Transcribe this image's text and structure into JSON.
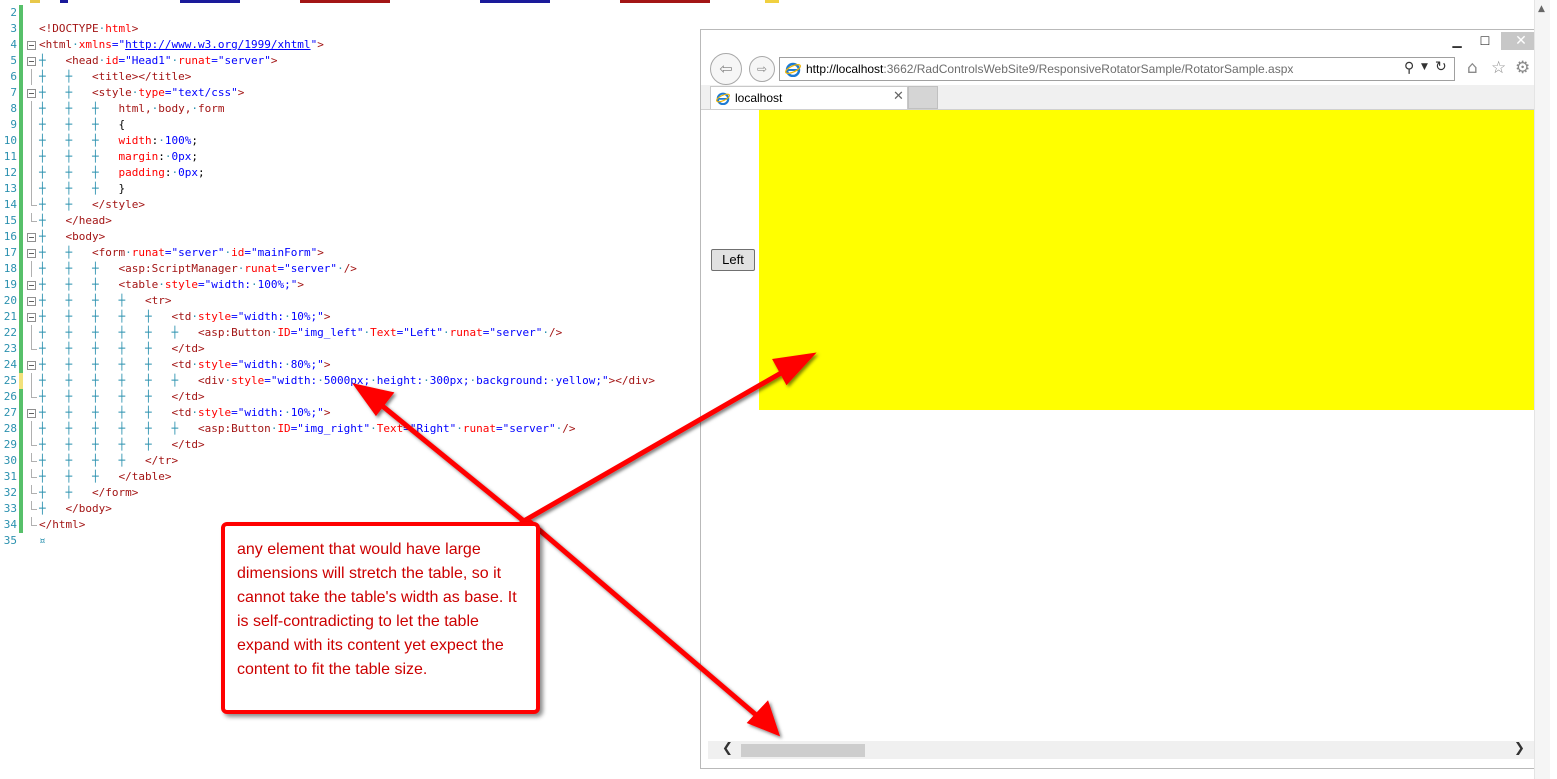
{
  "editor": {
    "lines": [
      {
        "n": "2",
        "chg": "saved",
        "fold": "none",
        "tokens": []
      },
      {
        "n": "3",
        "chg": "saved",
        "fold": "none",
        "tokens": [
          [
            "t-tag",
            "<!DOCTYPE"
          ],
          [
            "t-ws",
            "·"
          ],
          [
            "t-attr",
            "html"
          ],
          [
            "t-tag",
            ">"
          ]
        ]
      },
      {
        "n": "4",
        "chg": "saved",
        "fold": "open",
        "tokens": [
          [
            "t-tag",
            "<html"
          ],
          [
            "t-ws",
            "·"
          ],
          [
            "t-attr",
            "xmlns"
          ],
          [
            "t-kw",
            "=\""
          ],
          [
            "t-lnk",
            "http://www.w3.org/1999/xhtml"
          ],
          [
            "t-kw",
            "\""
          ],
          [
            "t-tag",
            ">"
          ]
        ]
      },
      {
        "n": "5",
        "chg": "saved",
        "fold": "open",
        "tokens": [
          [
            "t-ws",
            "┼   "
          ],
          [
            "t-tag",
            "<head"
          ],
          [
            "t-ws",
            "·"
          ],
          [
            "t-attr",
            "id"
          ],
          [
            "t-kw",
            "=\"Head1\""
          ],
          [
            "t-ws",
            "·"
          ],
          [
            "t-attr",
            "runat"
          ],
          [
            "t-kw",
            "=\"server\""
          ],
          [
            "t-tag",
            ">"
          ]
        ]
      },
      {
        "n": "6",
        "chg": "saved",
        "fold": "line",
        "tokens": [
          [
            "t-ws",
            "┼   ┼   "
          ],
          [
            "t-tag",
            "<title></title>"
          ]
        ]
      },
      {
        "n": "7",
        "chg": "saved",
        "fold": "open",
        "tokens": [
          [
            "t-ws",
            "┼   ┼   "
          ],
          [
            "t-tag",
            "<style"
          ],
          [
            "t-ws",
            "·"
          ],
          [
            "t-attr",
            "type"
          ],
          [
            "t-kw",
            "=\"text/css\""
          ],
          [
            "t-tag",
            ">"
          ]
        ]
      },
      {
        "n": "8",
        "chg": "saved",
        "fold": "line",
        "tokens": [
          [
            "t-ws",
            "┼   ┼   ┼   "
          ],
          [
            "t-tag",
            "html,"
          ],
          [
            "t-ws",
            "·"
          ],
          [
            "t-tag",
            "body,"
          ],
          [
            "t-ws",
            "·"
          ],
          [
            "t-tag",
            "form"
          ]
        ]
      },
      {
        "n": "9",
        "chg": "saved",
        "fold": "line",
        "tokens": [
          [
            "t-ws",
            "┼   ┼   ┼   "
          ],
          [
            "t-plain",
            "{"
          ]
        ]
      },
      {
        "n": "10",
        "chg": "saved",
        "fold": "line",
        "tokens": [
          [
            "t-ws",
            "┼   ┼   ┼   "
          ],
          [
            "t-prop",
            "width"
          ],
          [
            "t-plain",
            ":"
          ],
          [
            "t-ws",
            "·"
          ],
          [
            "t-kw",
            "100%"
          ],
          [
            "t-plain",
            ";"
          ]
        ]
      },
      {
        "n": "11",
        "chg": "saved",
        "fold": "line",
        "tokens": [
          [
            "t-ws",
            "┼   ┼   ┼   "
          ],
          [
            "t-prop",
            "margin"
          ],
          [
            "t-plain",
            ":"
          ],
          [
            "t-ws",
            "·"
          ],
          [
            "t-kw",
            "0px"
          ],
          [
            "t-plain",
            ";"
          ]
        ]
      },
      {
        "n": "12",
        "chg": "saved",
        "fold": "line",
        "tokens": [
          [
            "t-ws",
            "┼   ┼   ┼   "
          ],
          [
            "t-prop",
            "padding"
          ],
          [
            "t-plain",
            ":"
          ],
          [
            "t-ws",
            "·"
          ],
          [
            "t-kw",
            "0px"
          ],
          [
            "t-plain",
            ";"
          ]
        ]
      },
      {
        "n": "13",
        "chg": "saved",
        "fold": "line",
        "tokens": [
          [
            "t-ws",
            "┼   ┼   ┼   "
          ],
          [
            "t-plain",
            "}"
          ]
        ]
      },
      {
        "n": "14",
        "chg": "saved",
        "fold": "end",
        "tokens": [
          [
            "t-ws",
            "┼   ┼   "
          ],
          [
            "t-tag",
            "</style>"
          ]
        ]
      },
      {
        "n": "15",
        "chg": "saved",
        "fold": "end",
        "tokens": [
          [
            "t-ws",
            "┼   "
          ],
          [
            "t-tag",
            "</head>"
          ]
        ]
      },
      {
        "n": "16",
        "chg": "saved",
        "fold": "open",
        "tokens": [
          [
            "t-ws",
            "┼   "
          ],
          [
            "t-tag",
            "<body>"
          ]
        ]
      },
      {
        "n": "17",
        "chg": "saved",
        "fold": "open",
        "tokens": [
          [
            "t-ws",
            "┼   ┼   "
          ],
          [
            "t-tag",
            "<form"
          ],
          [
            "t-ws",
            "·"
          ],
          [
            "t-attr",
            "runat"
          ],
          [
            "t-kw",
            "=\"server\""
          ],
          [
            "t-ws",
            "·"
          ],
          [
            "t-attr",
            "id"
          ],
          [
            "t-kw",
            "=\"mainForm\""
          ],
          [
            "t-tag",
            ">"
          ]
        ]
      },
      {
        "n": "18",
        "chg": "saved",
        "fold": "line",
        "tokens": [
          [
            "t-ws",
            "┼   ┼   ┼   "
          ],
          [
            "t-tag",
            "<asp:ScriptManager"
          ],
          [
            "t-ws",
            "·"
          ],
          [
            "t-attr",
            "runat"
          ],
          [
            "t-kw",
            "=\"server\""
          ],
          [
            "t-ws",
            "·"
          ],
          [
            "t-tag",
            "/>"
          ]
        ]
      },
      {
        "n": "19",
        "chg": "saved",
        "fold": "open",
        "tokens": [
          [
            "t-ws",
            "┼   ┼   ┼   "
          ],
          [
            "t-tag",
            "<table"
          ],
          [
            "t-ws",
            "·"
          ],
          [
            "t-attr",
            "style"
          ],
          [
            "t-kw",
            "=\"width:"
          ],
          [
            "t-ws",
            "·"
          ],
          [
            "t-kw",
            "100%;\""
          ],
          [
            "t-tag",
            ">"
          ]
        ]
      },
      {
        "n": "20",
        "chg": "saved",
        "fold": "open",
        "tokens": [
          [
            "t-ws",
            "┼   ┼   ┼   ┼   "
          ],
          [
            "t-tag",
            "<tr>"
          ]
        ]
      },
      {
        "n": "21",
        "chg": "saved",
        "fold": "open",
        "tokens": [
          [
            "t-ws",
            "┼   ┼   ┼   ┼   ┼   "
          ],
          [
            "t-tag",
            "<td"
          ],
          [
            "t-ws",
            "·"
          ],
          [
            "t-attr",
            "style"
          ],
          [
            "t-kw",
            "=\"width:"
          ],
          [
            "t-ws",
            "·"
          ],
          [
            "t-kw",
            "10%;\""
          ],
          [
            "t-tag",
            ">"
          ]
        ]
      },
      {
        "n": "22",
        "chg": "saved",
        "fold": "line",
        "tokens": [
          [
            "t-ws",
            "┼   ┼   ┼   ┼   ┼   ┼   "
          ],
          [
            "t-tag",
            "<asp:Button"
          ],
          [
            "t-ws",
            "·"
          ],
          [
            "t-attr",
            "ID"
          ],
          [
            "t-kw",
            "=\"img_left\""
          ],
          [
            "t-ws",
            "·"
          ],
          [
            "t-attr",
            "Text"
          ],
          [
            "t-kw",
            "=\"Left\""
          ],
          [
            "t-ws",
            "·"
          ],
          [
            "t-attr",
            "runat"
          ],
          [
            "t-kw",
            "=\"server\""
          ],
          [
            "t-ws",
            "·"
          ],
          [
            "t-tag",
            "/>"
          ]
        ]
      },
      {
        "n": "23",
        "chg": "saved",
        "fold": "end",
        "tokens": [
          [
            "t-ws",
            "┼   ┼   ┼   ┼   ┼   "
          ],
          [
            "t-tag",
            "</td>"
          ]
        ]
      },
      {
        "n": "24",
        "chg": "saved",
        "fold": "open",
        "tokens": [
          [
            "t-ws",
            "┼   ┼   ┼   ┼   ┼   "
          ],
          [
            "t-tag",
            "<td"
          ],
          [
            "t-ws",
            "·"
          ],
          [
            "t-attr",
            "style"
          ],
          [
            "t-kw",
            "=\"width:"
          ],
          [
            "t-ws",
            "·"
          ],
          [
            "t-kw",
            "80%;\""
          ],
          [
            "t-tag",
            ">"
          ]
        ]
      },
      {
        "n": "25",
        "chg": "unsaved",
        "fold": "line",
        "tokens": [
          [
            "t-ws",
            "┼   ┼   ┼   ┼   ┼   ┼   "
          ],
          [
            "t-tag",
            "<div"
          ],
          [
            "t-ws",
            "·"
          ],
          [
            "t-attr",
            "style"
          ],
          [
            "t-kw",
            "=\"width:"
          ],
          [
            "t-ws",
            "·"
          ],
          [
            "t-kw",
            "5000px;"
          ],
          [
            "t-ws",
            "·"
          ],
          [
            "t-kw",
            "height:"
          ],
          [
            "t-ws",
            "·"
          ],
          [
            "t-kw",
            "300px;"
          ],
          [
            "t-ws",
            "·"
          ],
          [
            "t-kw",
            "background:"
          ],
          [
            "t-ws",
            "·"
          ],
          [
            "t-kw",
            "yellow;\""
          ],
          [
            "t-tag",
            "></div>"
          ]
        ]
      },
      {
        "n": "26",
        "chg": "saved",
        "fold": "end",
        "tokens": [
          [
            "t-ws",
            "┼   ┼   ┼   ┼   ┼   "
          ],
          [
            "t-tag",
            "</td>"
          ]
        ]
      },
      {
        "n": "27",
        "chg": "saved",
        "fold": "open",
        "tokens": [
          [
            "t-ws",
            "┼   ┼   ┼   ┼   ┼   "
          ],
          [
            "t-tag",
            "<td"
          ],
          [
            "t-ws",
            "·"
          ],
          [
            "t-attr",
            "style"
          ],
          [
            "t-kw",
            "=\"width:"
          ],
          [
            "t-ws",
            "·"
          ],
          [
            "t-kw",
            "10%;\""
          ],
          [
            "t-tag",
            ">"
          ]
        ]
      },
      {
        "n": "28",
        "chg": "saved",
        "fold": "line",
        "tokens": [
          [
            "t-ws",
            "┼   ┼   ┼   ┼   ┼   ┼   "
          ],
          [
            "t-tag",
            "<asp:Button"
          ],
          [
            "t-ws",
            "·"
          ],
          [
            "t-attr",
            "ID"
          ],
          [
            "t-kw",
            "=\"img_right\""
          ],
          [
            "t-ws",
            "·"
          ],
          [
            "t-attr",
            "Text"
          ],
          [
            "t-kw",
            "=\"Right\""
          ],
          [
            "t-ws",
            "·"
          ],
          [
            "t-attr",
            "runat"
          ],
          [
            "t-kw",
            "=\"server\""
          ],
          [
            "t-ws",
            "·"
          ],
          [
            "t-tag",
            "/>"
          ]
        ]
      },
      {
        "n": "29",
        "chg": "saved",
        "fold": "end",
        "tokens": [
          [
            "t-ws",
            "┼   ┼   ┼   ┼   ┼   "
          ],
          [
            "t-tag",
            "</td>"
          ]
        ]
      },
      {
        "n": "30",
        "chg": "saved",
        "fold": "end",
        "tokens": [
          [
            "t-ws",
            "┼   ┼   ┼   ┼   "
          ],
          [
            "t-tag",
            "</tr>"
          ]
        ]
      },
      {
        "n": "31",
        "chg": "saved",
        "fold": "end",
        "tokens": [
          [
            "t-ws",
            "┼   ┼   ┼   "
          ],
          [
            "t-tag",
            "</table>"
          ]
        ]
      },
      {
        "n": "32",
        "chg": "saved",
        "fold": "end",
        "tokens": [
          [
            "t-ws",
            "┼   ┼   "
          ],
          [
            "t-tag",
            "</form>"
          ]
        ]
      },
      {
        "n": "33",
        "chg": "saved",
        "fold": "end",
        "tokens": [
          [
            "t-ws",
            "┼   "
          ],
          [
            "t-tag",
            "</body>"
          ]
        ]
      },
      {
        "n": "34",
        "chg": "saved",
        "fold": "end",
        "tokens": [
          [
            "t-tag",
            "</html>"
          ]
        ]
      },
      {
        "n": "35",
        "chg": "none",
        "fold": "none",
        "tokens": [
          [
            "t-ws",
            "¤"
          ]
        ]
      }
    ]
  },
  "browser": {
    "url_host": "http://localhost",
    "url_path": ":3662/RadControlsWebSite9/ResponsiveRotatorSample/RotatorSample.aspx",
    "tab_title": "localhost",
    "left_button": "Left",
    "div_color": "#ffff00",
    "icons": {
      "minimize": "minimize-icon",
      "maximize": "maximize-icon",
      "close": "close-icon",
      "back": "back-arrow-icon",
      "forward": "forward-arrow-icon",
      "ie": "internet-explorer-icon",
      "search": "search-icon",
      "refresh": "refresh-icon",
      "home": "home-icon",
      "favorites": "star-icon",
      "settings": "gear-icon"
    }
  },
  "annotation": {
    "text": "any element that would have large dimensions will stretch the table, so it cannot take the table's width as base. It is self-contradicting to let the table expand with its content yet expect the content to fit the table size.",
    "color": "#ff0000"
  }
}
